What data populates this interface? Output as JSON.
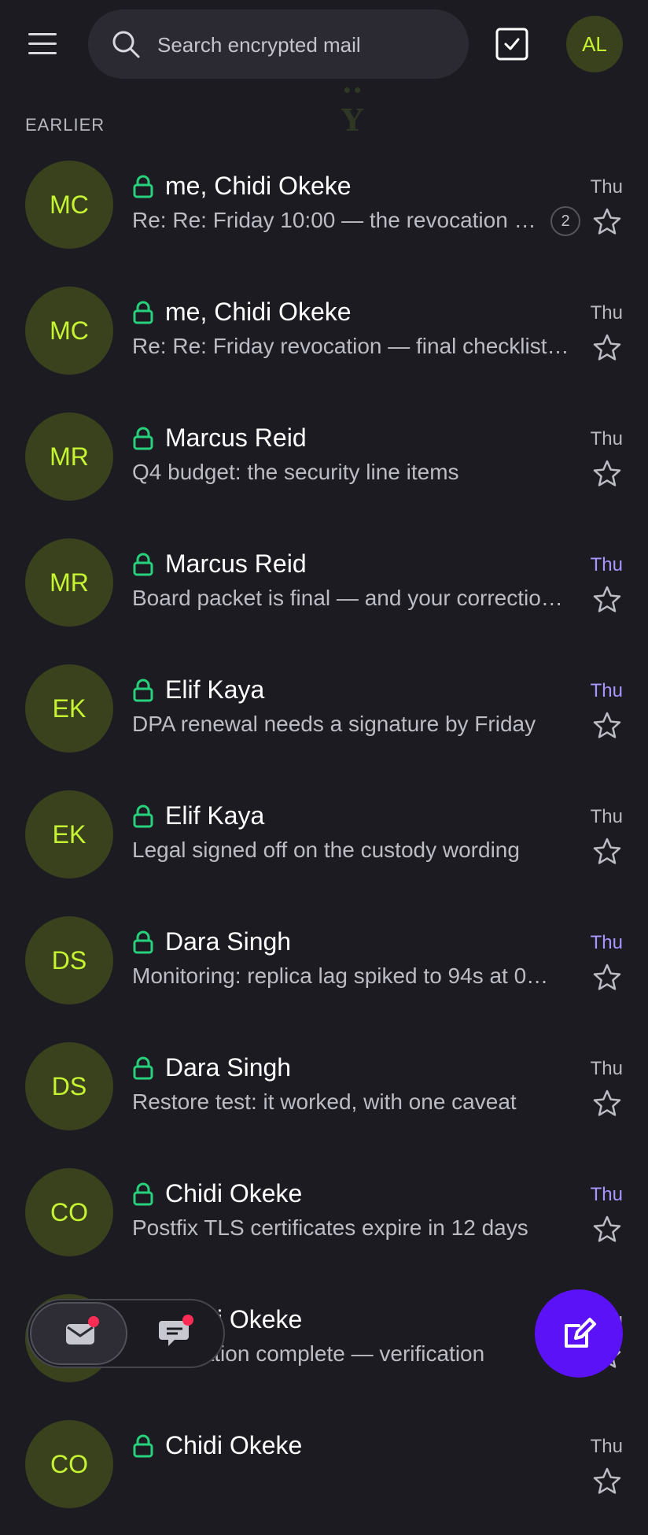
{
  "search": {
    "placeholder": "Search encrypted mail"
  },
  "user": {
    "initials": "AL"
  },
  "watermark": "··\nY",
  "section_label": "EARLIER",
  "colors": {
    "background": "#1c1b22",
    "avatar_bg": "#39421d",
    "avatar_text": "#c6f432",
    "lock": "#28d17c",
    "unread_date": "#a995ff",
    "fab": "#5b12f7",
    "notification_dot": "#ff2d55"
  },
  "emails": [
    {
      "initials": "MC",
      "sender": "me, Chidi Okeke",
      "subject": "Re: Re: Friday 10:00 — the revocation …",
      "date": "Thu",
      "unread": false,
      "count": "2"
    },
    {
      "initials": "MC",
      "sender": "me, Chidi Okeke",
      "subject": "Re: Re: Friday revocation — final checklist…",
      "date": "Thu",
      "unread": false,
      "count": ""
    },
    {
      "initials": "MR",
      "sender": "Marcus Reid",
      "subject": "Q4 budget: the security line items",
      "date": "Thu",
      "unread": false,
      "count": ""
    },
    {
      "initials": "MR",
      "sender": "Marcus Reid",
      "subject": "Board packet is final — and your correctio…",
      "date": "Thu",
      "unread": true,
      "count": ""
    },
    {
      "initials": "EK",
      "sender": "Elif Kaya",
      "subject": "DPA renewal needs a signature by Friday",
      "date": "Thu",
      "unread": true,
      "count": ""
    },
    {
      "initials": "EK",
      "sender": "Elif Kaya",
      "subject": "Legal signed off on the custody wording",
      "date": "Thu",
      "unread": false,
      "count": ""
    },
    {
      "initials": "DS",
      "sender": "Dara Singh",
      "subject": "Monitoring: replica lag spiked to 94s at 0…",
      "date": "Thu",
      "unread": true,
      "count": ""
    },
    {
      "initials": "DS",
      "sender": "Dara Singh",
      "subject": "Restore test: it worked, with one caveat",
      "date": "Thu",
      "unread": false,
      "count": ""
    },
    {
      "initials": "CO",
      "sender": "Chidi Okeke",
      "subject": "Postfix TLS certificates expire in 12 days",
      "date": "Thu",
      "unread": true,
      "count": ""
    },
    {
      "initials": "CO",
      "sender": "Chidi Okeke",
      "subject": "Key rotation complete — verification",
      "date": "Thu",
      "unread": false,
      "count": ""
    },
    {
      "initials": "CO",
      "sender": "Chidi Okeke",
      "subject": "",
      "date": "Thu",
      "unread": false,
      "count": ""
    }
  ],
  "icons": {
    "menu": "menu-icon",
    "search": "search-icon",
    "select": "checkbox-icon",
    "lock": "lock-icon",
    "star": "star-icon",
    "mail": "mail-icon",
    "chat": "chat-icon",
    "compose": "pencil-icon"
  }
}
